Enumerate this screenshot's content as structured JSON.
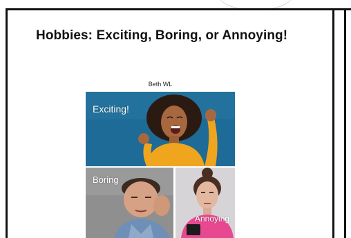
{
  "document": {
    "title": "Hobbies: Exciting, Boring, or Annoying!",
    "author": "Beth WL"
  },
  "panels": [
    {
      "caption": "Exciting!",
      "background": "#1f6f9a",
      "accent": "#f0a51e"
    },
    {
      "caption": "Boring",
      "background": "#8e8e8e",
      "accent": "#6d8fb8"
    },
    {
      "caption": "Annoying",
      "background": "#d4d2d4",
      "accent": "#e7488f"
    }
  ]
}
